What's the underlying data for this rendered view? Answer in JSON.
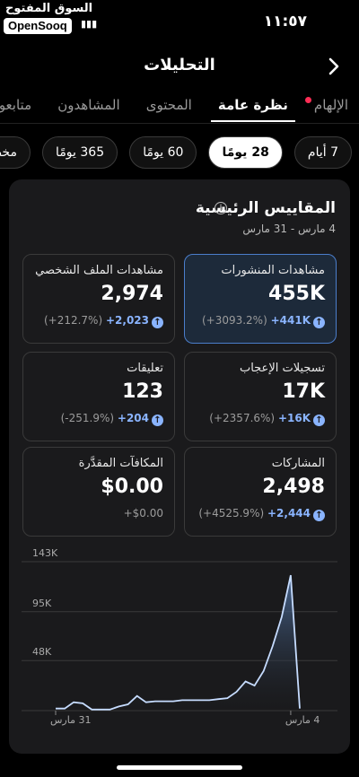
{
  "status_bar": {
    "time": "١١:٥٧",
    "watermark_ar": "السوق المفتوح",
    "watermark_en": "OpenSooq",
    "icons_text": "▮▮▮"
  },
  "header": {
    "title": "التحليلات"
  },
  "tabs": [
    {
      "label": "الإلهام",
      "has_dot": true
    },
    {
      "label": "نظرة عامة",
      "active": true
    },
    {
      "label": "المحتوى"
    },
    {
      "label": "المشاهدون"
    },
    {
      "label": "متابعون"
    }
  ],
  "ranges": [
    {
      "label": "7 أيام"
    },
    {
      "label": "28 يومًا",
      "active": true
    },
    {
      "label": "60 يومًا"
    },
    {
      "label": "365 يومًا"
    },
    {
      "label": "مخص"
    }
  ],
  "panel": {
    "title": "المقاييس الرئيسية",
    "subtitle": "4 مارس - 31 مارس",
    "info_glyph": "i"
  },
  "cards": [
    {
      "label": "مشاهدات المنشورات",
      "value": "455K",
      "delta": "+441K",
      "pct": "(+3093.2%)",
      "selected": true
    },
    {
      "label": "مشاهدات الملف الشخصي",
      "value": "2,974",
      "delta": "+2,023",
      "pct": "(+212.7%)"
    },
    {
      "label": "تسجيلات الإعجاب",
      "value": "17K",
      "delta": "+16K",
      "pct": "(+2357.6%)"
    },
    {
      "label": "تعليقات",
      "value": "123",
      "delta": "+204",
      "pct": "(-251.9%)"
    },
    {
      "label": "المشاركات",
      "value": "2,498",
      "delta": "+2,444",
      "pct": "(+4525.9%)"
    },
    {
      "label": "المكافآت المقدَّرة",
      "value": "$0.00",
      "delta": "+$0.00",
      "pct": ""
    }
  ],
  "chart_data": {
    "type": "area",
    "ylim": [
      0,
      143
    ],
    "yticks": [
      "143K",
      "95K",
      "48K"
    ],
    "ytick_values": [
      143,
      95,
      48
    ],
    "xtick_labels": [
      "31 مارس",
      "4 مارس"
    ],
    "x": [
      1,
      2,
      3,
      4,
      5,
      6,
      7,
      8,
      9,
      10,
      11,
      12,
      13,
      14,
      15,
      16,
      17,
      18,
      19,
      20,
      21,
      22,
      23,
      24,
      25,
      26,
      27,
      28
    ],
    "values": [
      2,
      2,
      8,
      7,
      1,
      1,
      1,
      4,
      6,
      14,
      8,
      9,
      9,
      9,
      10,
      10,
      10,
      10,
      11,
      12,
      18,
      28,
      24,
      38,
      62,
      90,
      130,
      2
    ],
    "colors": {
      "line": "#c6dcff",
      "fill_top": "#4e6f9e",
      "fill_bottom": "#1a1a1c",
      "grid": "#3a3a3a"
    }
  }
}
